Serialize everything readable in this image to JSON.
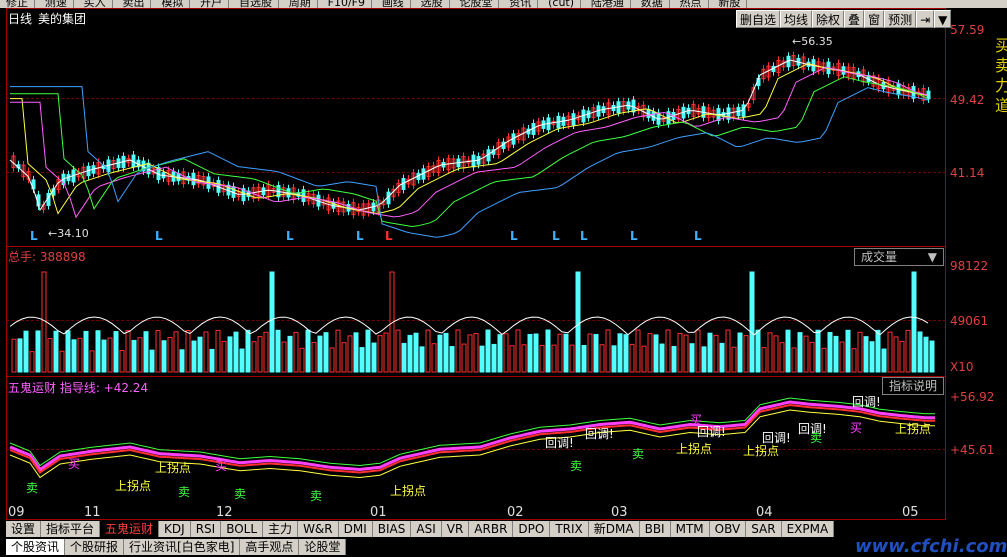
{
  "toolbar": {
    "items": [
      "修正",
      "测速",
      "买入",
      "卖出",
      "模拟",
      "开户",
      "自选股",
      "周期",
      "F10/F9",
      "画线",
      "选股",
      "论股堂",
      "资讯",
      "(cut)",
      "陆港通",
      "数据",
      "热点",
      "新股"
    ]
  },
  "stock": {
    "period": "日线",
    "name": "美的集团"
  },
  "func_buttons": [
    "删自选",
    "均线",
    "除权",
    "叠",
    "窗",
    "预测",
    "⇥",
    "▼"
  ],
  "price_axis": {
    "labels": [
      "57.59",
      "49.42",
      "41.14"
    ]
  },
  "annotations": {
    "high": "56.35",
    "low": "34.10"
  },
  "l_marks": [
    "L",
    "L",
    "L",
    "L",
    "L",
    "L",
    "L",
    "L",
    "L",
    "L"
  ],
  "volume": {
    "label": "总手: 388898",
    "indicator": "成交量",
    "axis": [
      "98122",
      "49061"
    ],
    "unit": "X10"
  },
  "indicator": {
    "label": "五鬼运财 指导线: +42.24",
    "explain": "指标说明",
    "axis": [
      "+56.92",
      "+45.61"
    ]
  },
  "indicator_texts": {
    "buy": "买",
    "sell": "卖",
    "upturn": "上拐点",
    "callback": "回调!"
  },
  "x_axis": [
    "09",
    "11",
    "12",
    "01",
    "02",
    "03",
    "04",
    "05"
  ],
  "right_panel": "买卖力道",
  "bottom_tabs": [
    "设置",
    "指标平台",
    "五鬼运财",
    "KDJ",
    "RSI",
    "BOLL",
    "主力",
    "W&R",
    "DMI",
    "BIAS",
    "ASI",
    "VR",
    "ARBR",
    "DPO",
    "TRIX",
    "新DMA",
    "BBI",
    "MTM",
    "OBV",
    "SAR",
    "EXPMA"
  ],
  "bottom_row2": [
    "个股资讯",
    "个股研报",
    "行业资讯[白色家电]",
    "高手观点",
    "论股堂"
  ],
  "watermark": "www.cfchi.com",
  "colors": {
    "up": "#ff3030",
    "down": "#54ffff",
    "frame": "#a00000",
    "ma_white": "#ffffff",
    "ma_yellow": "#ffff40",
    "ma_magenta": "#ff60ff",
    "ma_green": "#40ff40",
    "ma_blue": "#40a0ff"
  }
}
